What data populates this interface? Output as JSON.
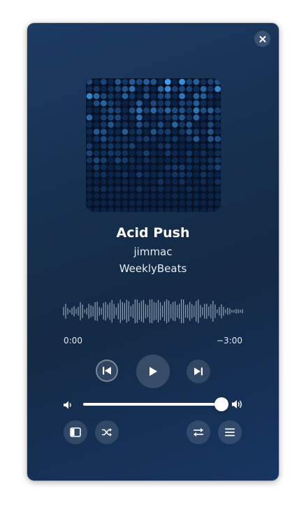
{
  "player": {
    "title": "Acid Push",
    "artist": "jimmac",
    "album": "WeeklyBeats",
    "elapsed": "0:00",
    "remaining": "−3:00",
    "progress": 0,
    "volume": 1.0
  },
  "icons": {
    "close": "close-icon",
    "previous": "skip-back-icon",
    "play": "play-icon",
    "next": "skip-forward-icon",
    "volume_low": "volume-low-icon",
    "volume_high": "volume-high-icon",
    "sidebar": "sidebar-icon",
    "shuffle": "shuffle-icon",
    "repeat": "repeat-icon",
    "queue": "queue-list-icon"
  },
  "colors": {
    "window_bg": "#17304f",
    "accent": "#ffffff",
    "waveform": "#8a9bb0"
  }
}
